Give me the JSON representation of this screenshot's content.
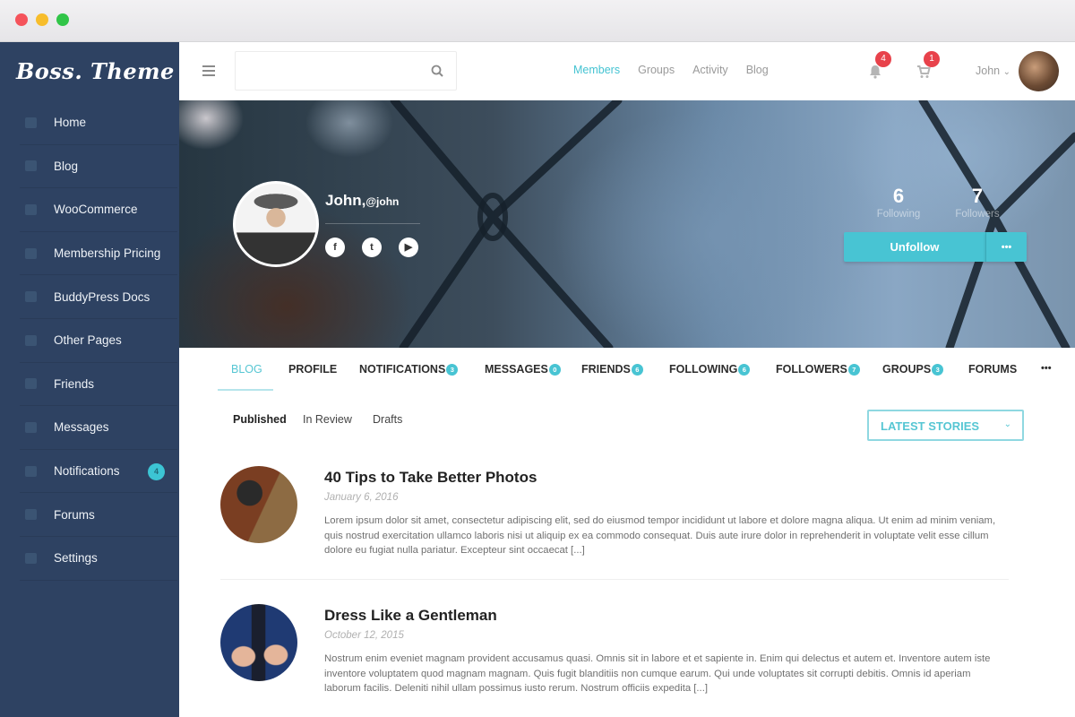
{
  "window": {
    "title_dots": [
      "close",
      "minimize",
      "maximize"
    ]
  },
  "sidebar": {
    "logo": "Boss. Theme",
    "items": [
      {
        "label": "Home",
        "icon": "home-icon"
      },
      {
        "label": "Blog",
        "icon": "blog-icon"
      },
      {
        "label": "WooCommerce",
        "icon": "store-icon"
      },
      {
        "label": "Membership Pricing",
        "icon": "page-icon"
      },
      {
        "label": "BuddyPress Docs",
        "icon": "folder-icon"
      },
      {
        "label": "Other Pages",
        "icon": "pages-icon"
      },
      {
        "label": "Friends",
        "icon": "friends-icon"
      },
      {
        "label": "Messages",
        "icon": "messages-icon"
      },
      {
        "label": "Notifications",
        "icon": "bell-icon",
        "badge": "4"
      },
      {
        "label": "Forums",
        "icon": "forums-icon"
      },
      {
        "label": "Settings",
        "icon": "settings-icon"
      }
    ]
  },
  "topbar": {
    "search": {
      "value": "",
      "placeholder": ""
    },
    "nav": [
      {
        "label": "Members",
        "active": true
      },
      {
        "label": "Groups",
        "active": false
      },
      {
        "label": "Activity",
        "active": false
      },
      {
        "label": "Blog",
        "active": false
      }
    ],
    "notifications_badge": "4",
    "cart_badge": "1",
    "username": "John",
    "user_caret": "⌄"
  },
  "profile": {
    "name": "John",
    "handle": "@john",
    "social": [
      "f",
      "t",
      "▶"
    ],
    "stats": [
      {
        "value": "6",
        "label": "Following"
      },
      {
        "value": "7",
        "label": "Followers"
      }
    ],
    "unfollow_label": "Unfollow",
    "more_label": "•••"
  },
  "tabs": [
    {
      "label": "BLOG",
      "active": true
    },
    {
      "label": "PROFILE"
    },
    {
      "label": "NOTIFICATIONS",
      "badge": "3"
    },
    {
      "label": "MESSAGES",
      "badge": "0"
    },
    {
      "label": "FRIENDS",
      "badge": "6"
    },
    {
      "label": "FOLLOWING",
      "badge": "6"
    },
    {
      "label": "FOLLOWERS",
      "badge": "7"
    },
    {
      "label": "GROUPS",
      "badge": "3"
    },
    {
      "label": "FORUMS"
    },
    {
      "label": "•••"
    }
  ],
  "subtabs": [
    {
      "label": "Published",
      "active": true
    },
    {
      "label": "In Review"
    },
    {
      "label": "Drafts"
    }
  ],
  "sort_select": {
    "value": "LATEST STORIES"
  },
  "posts": [
    {
      "title": "40 Tips to Take Better Photos",
      "date": "January 6, 2016",
      "excerpt": "Lorem ipsum dolor sit amet, consectetur adipiscing elit, sed do eiusmod tempor incididunt ut labore et dolore magna aliqua. Ut enim ad minim veniam, quis nostrud exercitation ullamco laboris nisi ut aliquip ex ea commodo consequat. Duis aute irure dolor in reprehenderit in voluptate velit esse cillum dolore eu fugiat nulla pariatur. Excepteur sint occaecat [...]"
    },
    {
      "title": "Dress Like a Gentleman",
      "date": "October 12, 2015",
      "excerpt": "Nostrum enim eveniet magnam provident accusamus quasi. Omnis sit in labore et et sapiente in. Enim qui delectus et autem et. Inventore autem iste inventore voluptatem quod magnam magnam. Quis fugit blanditiis non cumque earum. Qui unde voluptates sit corrupti debitis. Omnis id aperiam laborum facilis. Deleniti nihil ullam possimus iusto rerum. Nostrum officiis expedita [...]"
    }
  ],
  "colors": {
    "accent": "#48c4d3",
    "sidebar": "#2e4262",
    "badge_red": "#e8424b"
  }
}
